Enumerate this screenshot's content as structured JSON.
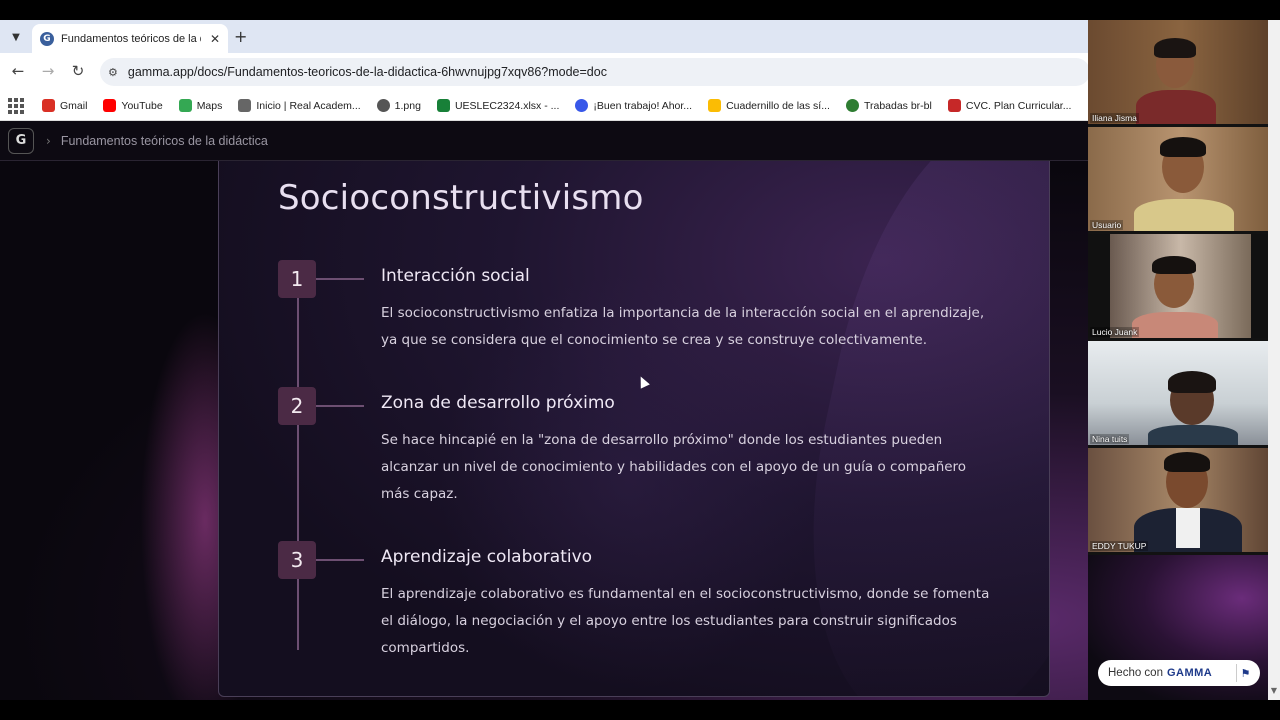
{
  "browser": {
    "tab": {
      "title": "Fundamentos teóricos de la didáctica",
      "favicon": "G"
    },
    "url": "gamma.app/docs/Fundamentos-teoricos-de-la-didactica-6hwvnujpg7xqv86?mode=doc",
    "bookmarks": [
      {
        "label": "Gmail",
        "icon": "gmail-icon",
        "color": "#d93025"
      },
      {
        "label": "YouTube",
        "icon": "youtube-icon",
        "color": "#ff0000"
      },
      {
        "label": "Maps",
        "icon": "maps-icon",
        "color": "#34a853"
      },
      {
        "label": "Inicio | Real Academ...",
        "icon": "rae-icon",
        "color": "#666666"
      },
      {
        "label": "1.png",
        "icon": "globe-icon",
        "color": "#555555"
      },
      {
        "label": "UESLEC2324.xlsx - ...",
        "icon": "sheets-icon",
        "color": "#188038"
      },
      {
        "label": "¡Buen trabajo! Ahor...",
        "icon": "wordpress-icon",
        "color": "#3858e9"
      },
      {
        "label": "Cuadernillo de las sí...",
        "icon": "drive-icon",
        "color": "#fbbc04"
      },
      {
        "label": "Trabadas br-bl",
        "icon": "site-icon",
        "color": "#2e7d32"
      },
      {
        "label": "CVC. Plan Curricular...",
        "icon": "cvc-icon",
        "color": "#c62828"
      }
    ]
  },
  "app": {
    "logo": "G",
    "breadcrumb": "Fundamentos teóricos de la didáctica"
  },
  "doc": {
    "heading": "Socioconstructivismo",
    "steps": [
      {
        "num": "1",
        "title": "Interacción social",
        "body": "El socioconstructivismo enfatiza la importancia de la interacción social en el aprendizaje, ya que se considera que el conocimiento se crea y se construye colectivamente."
      },
      {
        "num": "2",
        "title": "Zona de desarrollo próximo",
        "body": "Se hace hincapié en la \"zona de desarrollo próximo\" donde los estudiantes pueden alcanzar un nivel de conocimiento y habilidades con el apoyo de un guía o compañero más capaz."
      },
      {
        "num": "3",
        "title": "Aprendizaje colaborativo",
        "body": "El aprendizaje colaborativo es fundamental en el socioconstructivismo, donde se fomenta el diálogo, la negociación y el apoyo entre los estudiantes para construir significados compartidos."
      }
    ]
  },
  "participants": [
    {
      "name": "Iliana Jisma"
    },
    {
      "name": "Usuario"
    },
    {
      "name": "Lucio Juank"
    },
    {
      "name": "Nina tuits"
    },
    {
      "name": "EDDY TUKUP"
    }
  ],
  "badge": {
    "prefix": "Hecho con",
    "brand": "GAMMA"
  }
}
